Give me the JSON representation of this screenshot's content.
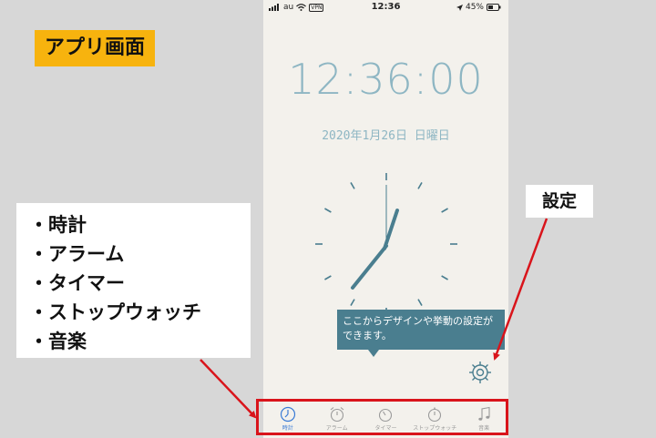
{
  "status_bar": {
    "carrier": "au",
    "vpn": "VPN",
    "time": "12:36",
    "battery": "45%"
  },
  "clock": {
    "digital_time": "12:36:00",
    "date": "2020年1月26日  日曜日"
  },
  "tooltip": {
    "text": "ここからデザインや挙動の設定ができます。"
  },
  "tabs": [
    {
      "label": "時計",
      "icon": "clock-icon",
      "active": true
    },
    {
      "label": "アラーム",
      "icon": "alarm-icon",
      "active": false
    },
    {
      "label": "タイマー",
      "icon": "timer-icon",
      "active": false
    },
    {
      "label": "ストップウォッチ",
      "icon": "stopwatch-icon",
      "active": false
    },
    {
      "label": "音楽",
      "icon": "music-icon",
      "active": false
    }
  ],
  "annotations": {
    "title": "アプリ画面",
    "settings_label": "設定",
    "feature_list": [
      "・時計",
      "・アラーム",
      "・タイマー",
      "・ストップウォッチ",
      "・音楽"
    ]
  },
  "colors": {
    "accent": "#4a7e8f",
    "highlight_border": "#d9141b",
    "title_badge": "#f7b30e",
    "active_tab": "#3a7bd5"
  }
}
